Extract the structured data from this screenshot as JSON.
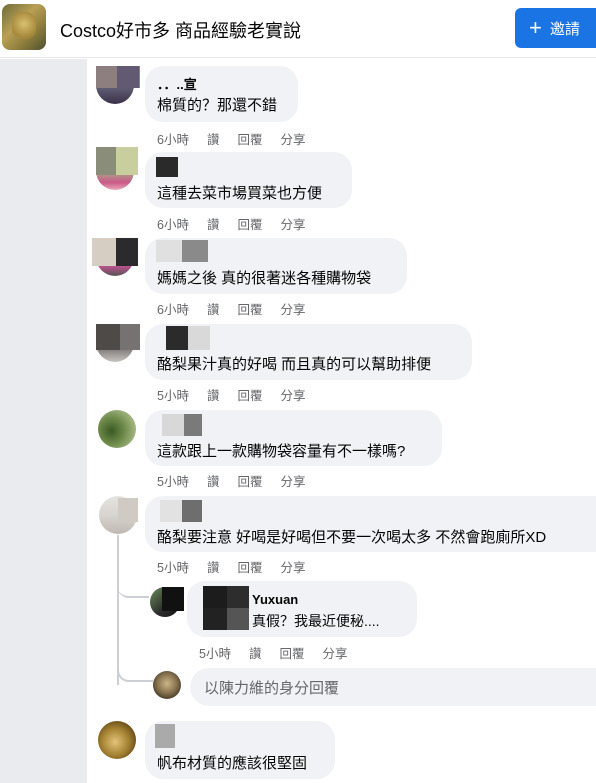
{
  "header": {
    "group_name": "Costco好市多 商品經驗老實說",
    "invite_label": "邀請",
    "invite_icon": "plus-icon"
  },
  "comments": [
    {
      "name_fragment": "．．..宣",
      "text": "棉質的？那還不錯",
      "time": "6小時",
      "like": "讚",
      "reply": "回覆",
      "share": "分享"
    },
    {
      "text": "這種去菜市場買菜也方便",
      "time": "6小時",
      "like": "讚",
      "reply": "回覆",
      "share": "分享"
    },
    {
      "text": "媽媽之後 真的很著迷各種購物袋",
      "time": "6小時",
      "like": "讚",
      "reply": "回覆",
      "share": "分享"
    },
    {
      "text": "酪梨果汁真的好喝 而且真的可以幫助排便",
      "time": "5小時",
      "like": "讚",
      "reply": "回覆",
      "share": "分享"
    },
    {
      "text": "這款跟上一款購物袋容量有不一樣嗎?",
      "time": "5小時",
      "like": "讚",
      "reply": "回覆",
      "share": "分享"
    },
    {
      "text": "酪梨要注意 好喝是好喝但不要一次喝太多 不然會跑廁所XD",
      "time": "5小時",
      "like": "讚",
      "reply": "回覆",
      "share": "分享"
    },
    {
      "text": "帆布材質的應該很堅固"
    }
  ],
  "reply": {
    "name": "Yuxuan",
    "text": "真假？我最近便秘....",
    "time": "5小時",
    "like": "讚",
    "reply": "回覆",
    "share": "分享"
  },
  "reply_input": {
    "placeholder": "以陳力維的身分回覆"
  },
  "colors": {
    "accent": "#1b74e4",
    "bubble": "#f0f2f5",
    "meta_text": "#65676b",
    "left_strip": "#e9ebee"
  }
}
